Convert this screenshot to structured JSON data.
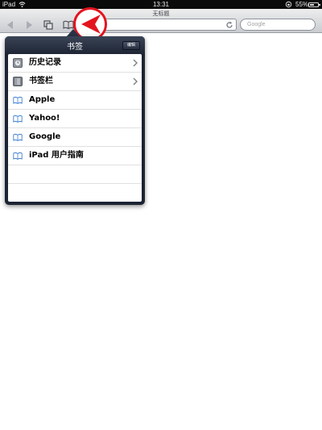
{
  "status_bar": {
    "device": "iPad",
    "time": "13:31",
    "battery_percent": "55%",
    "battery_level": 0.55
  },
  "toolbar": {
    "page_title": "无标题",
    "search_placeholder": "Google"
  },
  "bookmarks_popover": {
    "title": "书签",
    "edit_label": "编辑",
    "items": [
      {
        "label": "历史记录",
        "icon": "history-icon"
      },
      {
        "label": "书签栏",
        "icon": "folder-icon"
      },
      {
        "label": "Apple",
        "icon": "bookmark-icon"
      },
      {
        "label": "Yahoo!",
        "icon": "bookmark-icon"
      },
      {
        "label": "Google",
        "icon": "bookmark-icon"
      },
      {
        "label": "iPad 用户指南",
        "icon": "bookmark-icon"
      }
    ]
  },
  "colors": {
    "highlight": "#e3141e",
    "popover_bg": "#1c2333"
  }
}
